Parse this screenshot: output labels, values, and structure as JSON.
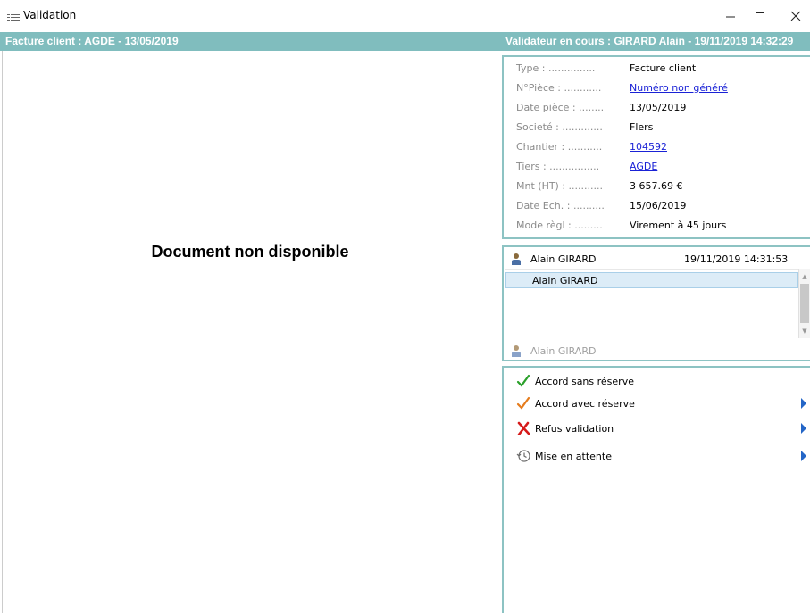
{
  "window": {
    "title": "Validation",
    "controls": {
      "minimize_icon": "minimize-icon",
      "maximize_icon": "maximize-icon",
      "close_icon": "close-icon"
    }
  },
  "header": {
    "left": "Facture client : AGDE - 13/05/2019",
    "right": "Validateur en cours : GIRARD Alain - 19/11/2019 14:32:29",
    "bg_color": "#80bdbe"
  },
  "document": {
    "message": "Document non disponible"
  },
  "info": {
    "rows": [
      {
        "label": "Type : ...............",
        "value": "Facture client",
        "link": false
      },
      {
        "label": "N°Pièce : ............",
        "value": "Numéro non généré",
        "link": true
      },
      {
        "label": "Date pièce : ........",
        "value": "13/05/2019",
        "link": false
      },
      {
        "label": "Societé : .............",
        "value": "Flers",
        "link": false
      },
      {
        "label": "Chantier : ...........",
        "value": "104592",
        "link": true
      },
      {
        "label": "Tiers : ................",
        "value": "AGDE",
        "link": true
      },
      {
        "label": "Mnt (HT) : ...........",
        "value": "3 657.69 €",
        "link": false
      },
      {
        "label": "Date Ech. : ..........",
        "value": "15/06/2019",
        "link": false
      },
      {
        "label": "Mode règl : .........",
        "value": "Virement à 45 jours",
        "link": false
      }
    ]
  },
  "validators": {
    "current_name": "Alain GIRARD",
    "current_date": "19/11/2019 14:31:53",
    "list": [
      "Alain GIRARD"
    ],
    "input_value": "Alain GIRARD",
    "person_icon": "person-icon"
  },
  "actions": [
    {
      "label": "Accord sans réserve",
      "icon": "check-green-icon",
      "color": "#2aa02a",
      "has_submenu": false
    },
    {
      "label": "Accord avec réserve",
      "icon": "check-orange-icon",
      "color": "#e57c1d",
      "has_submenu": true
    },
    {
      "label": "Refus validation",
      "icon": "cross-red-icon",
      "color": "#d61a1a",
      "has_submenu": true
    },
    {
      "label": "Mise en attente",
      "icon": "clock-history-icon",
      "color": "#6b6b6b",
      "has_submenu": true
    }
  ],
  "colors": {
    "link": "#1a22d6",
    "panel_border": "#8dc3c3",
    "chevron": "#2466c7",
    "selected_row": "#dcecf7"
  }
}
